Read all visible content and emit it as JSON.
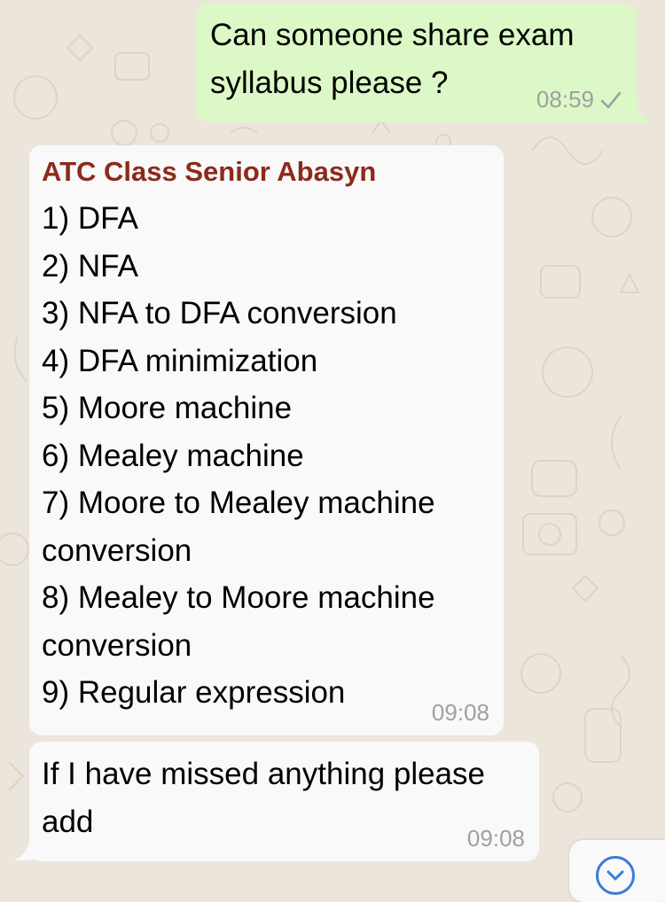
{
  "chat": {
    "messages": [
      {
        "direction": "outgoing",
        "text": "Can someone share exam\nsyllabus please ?",
        "time": "08:59",
        "status_icon": "single-check-icon"
      },
      {
        "direction": "incoming",
        "sender": "ATC Class Senior Abasyn",
        "sender_color": "#8C2A1C",
        "lines": [
          "1) DFA",
          "2) NFA",
          "3) NFA to DFA conversion",
          "4) DFA minimization",
          "5) Moore machine",
          "6) Mealey machine",
          "7) Moore to Mealey machine\nconversion",
          "8) Mealey to Moore machine\nconversion",
          "9) Regular expression"
        ],
        "time": "09:08"
      },
      {
        "direction": "incoming",
        "text": "If I have missed anything please\nadd",
        "time": "09:08"
      }
    ],
    "scroll_to_bottom_icon": "chevron-down-circle-icon"
  },
  "colors": {
    "background": "#ECE5DC",
    "outgoing_bubble": "#DCF8C6",
    "incoming_bubble": "#F9F9F9",
    "timestamp": "#A0A0A0",
    "accent": "#3A7BDB"
  }
}
